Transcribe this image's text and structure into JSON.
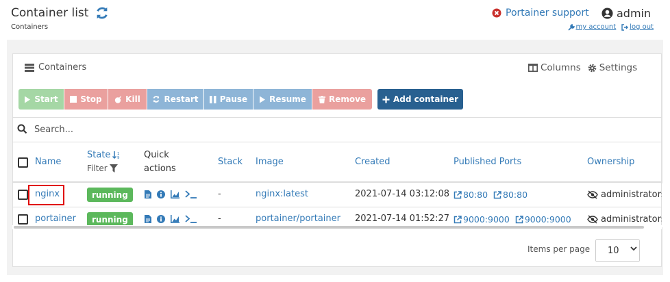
{
  "header": {
    "title": "Container list",
    "subtitle": "Containers",
    "support_label": "Portainer support",
    "user": "admin",
    "my_account": "my account",
    "log_out": "log out"
  },
  "widget": {
    "title": "Containers",
    "columns_label": "Columns",
    "settings_label": "Settings"
  },
  "actions": {
    "start": "Start",
    "stop": "Stop",
    "kill": "Kill",
    "restart": "Restart",
    "pause": "Pause",
    "resume": "Resume",
    "remove": "Remove",
    "add": "Add container"
  },
  "search": {
    "placeholder": "Search..."
  },
  "table": {
    "headers": {
      "name": "Name",
      "state": "State",
      "filter": "Filter",
      "quick_actions_1": "Quick",
      "quick_actions_2": "actions",
      "stack": "Stack",
      "image": "Image",
      "created": "Created",
      "ports": "Published Ports",
      "ownership": "Ownership"
    },
    "rows": [
      {
        "name": "nginx",
        "state": "running",
        "stack": "-",
        "image": "nginx:latest",
        "created": "2021-07-14 03:12:08",
        "port1": "80:80",
        "port2": "80:80",
        "ownership": "administrators"
      },
      {
        "name": "portainer",
        "state": "running",
        "stack": "-",
        "image": "portainer/portainer",
        "created": "2021-07-14 01:52:27",
        "port1": "9000:9000",
        "port2": "9000:9000",
        "ownership": "administrators"
      }
    ]
  },
  "pagination": {
    "label": "Items per page",
    "value": "10"
  },
  "colors": {
    "start": "#5cb85c",
    "stop": "#d9534f",
    "restart": "#337ab7",
    "add": "#286090",
    "badge": "#5cb85c",
    "link": "#337ab7"
  }
}
